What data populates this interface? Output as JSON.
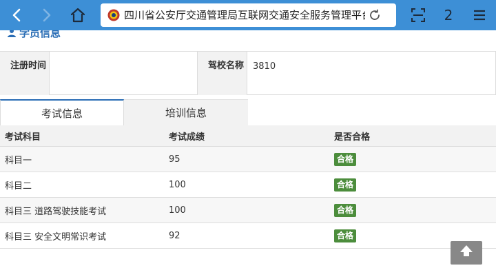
{
  "browser": {
    "url_title": "四川省公安厅交通管理局互联网交通安全服务管理平台",
    "tab_count": "2"
  },
  "section": {
    "title": "学员信息"
  },
  "info": {
    "reg_time_label": "注册时间",
    "reg_time_value": "",
    "school_label": "驾校名称",
    "school_value": "3810"
  },
  "tabs": [
    {
      "label": "考试信息",
      "active": true
    },
    {
      "label": "培训信息",
      "active": false
    }
  ],
  "results": {
    "headers": [
      "考试科目",
      "考试成绩",
      "是否合格"
    ],
    "rows": [
      {
        "subject": "科目一",
        "score": "95",
        "status": "合格"
      },
      {
        "subject": "科目二",
        "score": "100",
        "status": "合格"
      },
      {
        "subject": "科目三 道路驾驶技能考试",
        "score": "100",
        "status": "合格"
      },
      {
        "subject": "科目三 安全文明常识考试",
        "score": "92",
        "status": "合格"
      }
    ]
  },
  "colors": {
    "toolbar": "#3d8fd6",
    "accent": "#2a6db5",
    "pass_badge": "#4c8d3c"
  },
  "icons": [
    "chevron-left-icon",
    "chevron-right-icon",
    "home-icon",
    "police-badge-icon",
    "reload-icon",
    "scan-icon",
    "menu-icon",
    "user-icon",
    "arrow-up-icon"
  ]
}
